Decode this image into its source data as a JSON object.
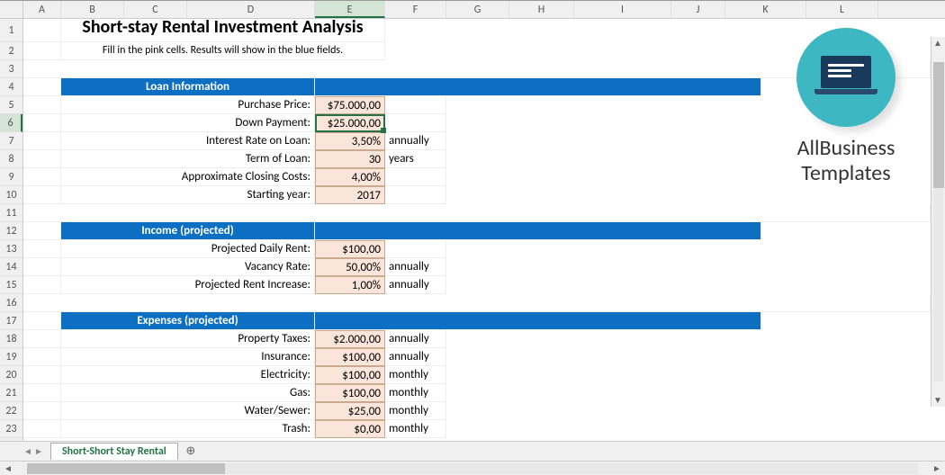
{
  "columns": [
    "A",
    "B",
    "C",
    "D",
    "E",
    "F",
    "G",
    "H",
    "I",
    "J",
    "K",
    "L"
  ],
  "rows": [
    1,
    2,
    3,
    4,
    5,
    6,
    7,
    8,
    9,
    10,
    11,
    12,
    13,
    14,
    15,
    16,
    17,
    18,
    19,
    20,
    21,
    22,
    23
  ],
  "selected": {
    "col": "E",
    "row": 6
  },
  "title": "Short-stay Rental Investment Analysis",
  "subtitle": "Fill in the  pink cells. Results will show in the blue fields.",
  "sections": {
    "loan": {
      "header": "Loan Information",
      "rows": [
        {
          "label": "Purchase Price:",
          "value": "$75.000,00",
          "unit": ""
        },
        {
          "label": "Down Payment:",
          "value": "$25.000,00",
          "unit": ""
        },
        {
          "label": "Interest Rate on Loan:",
          "value": "3,50%",
          "unit": "annually"
        },
        {
          "label": "Term of Loan:",
          "value": "30",
          "unit": "years"
        },
        {
          "label": "Approximate Closing Costs:",
          "value": "4,00%",
          "unit": ""
        },
        {
          "label": "Starting year:",
          "value": "2017",
          "unit": ""
        }
      ]
    },
    "income": {
      "header": "Income (projected)",
      "rows": [
        {
          "label": "Projected Daily Rent:",
          "value": "$100,00",
          "unit": ""
        },
        {
          "label": "Vacancy Rate:",
          "value": "50,00%",
          "unit": "annually"
        },
        {
          "label": "Projected Rent Increase:",
          "value": "1,00%",
          "unit": "annually"
        }
      ]
    },
    "expenses": {
      "header": "Expenses (projected)",
      "rows": [
        {
          "label": "Property Taxes:",
          "value": "$2.000,00",
          "unit": "annually"
        },
        {
          "label": "Insurance:",
          "value": "$100,00",
          "unit": "annually"
        },
        {
          "label": "Electricity:",
          "value": "$100,00",
          "unit": "monthly"
        },
        {
          "label": "Gas:",
          "value": "$100,00",
          "unit": "monthly"
        },
        {
          "label": "Water/Sewer:",
          "value": "$25,00",
          "unit": "monthly"
        },
        {
          "label": "Trash:",
          "value": "$0,00",
          "unit": "monthly"
        }
      ]
    }
  },
  "brand": {
    "line1": "AllBusiness",
    "line2": "Templates"
  },
  "sheet": "Short-Short Stay Rental"
}
